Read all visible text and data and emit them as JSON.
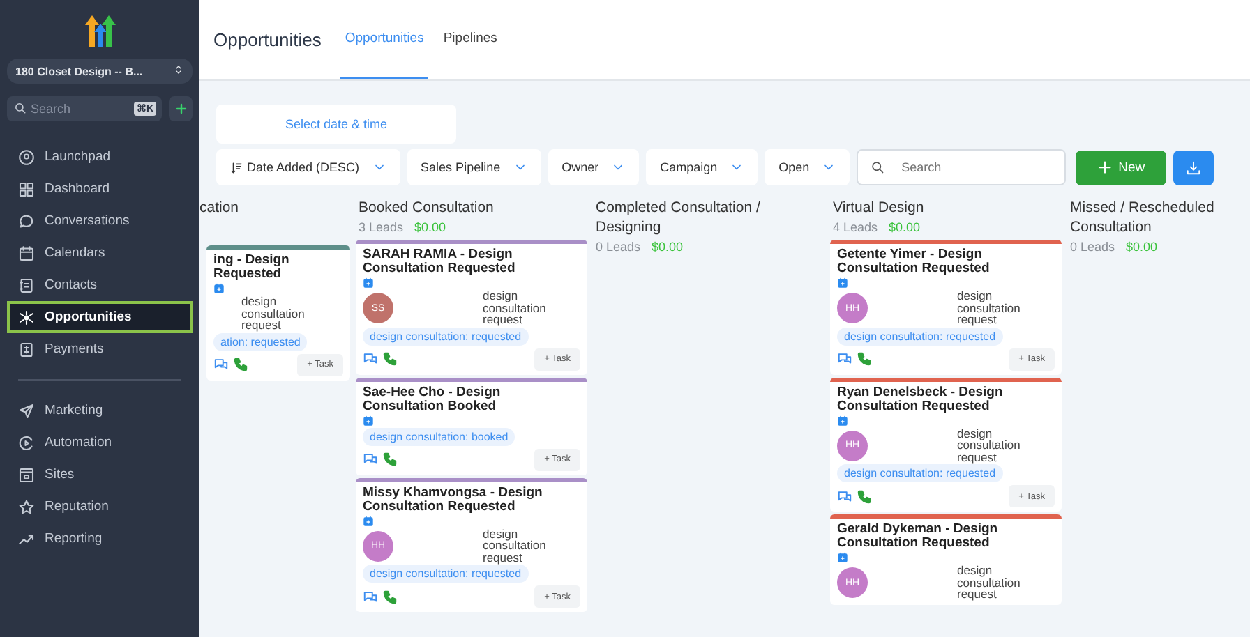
{
  "sidebar": {
    "account": "180 Closet Design -- B...",
    "search": {
      "placeholder": "Search",
      "shortcut": "⌘K"
    },
    "nav": [
      {
        "label": "Launchpad",
        "selected": false
      },
      {
        "label": "Dashboard",
        "selected": false
      },
      {
        "label": "Conversations",
        "selected": false
      },
      {
        "label": "Calendars",
        "selected": false
      },
      {
        "label": "Contacts",
        "selected": false
      },
      {
        "label": "Opportunities",
        "selected": true
      },
      {
        "label": "Payments",
        "selected": false
      }
    ],
    "nav_secondary": [
      {
        "label": "Marketing",
        "selected": false
      },
      {
        "label": "Automation",
        "selected": false
      },
      {
        "label": "Sites",
        "selected": false
      },
      {
        "label": "Reputation",
        "selected": false
      },
      {
        "label": "Reporting",
        "selected": false
      }
    ]
  },
  "header": {
    "title": "Opportunities",
    "tabs": [
      {
        "label": "Opportunities",
        "selected": true
      },
      {
        "label": "Pipelines",
        "selected": false
      }
    ]
  },
  "toolbar": {
    "date_picker": "Select date & time",
    "filters": [
      {
        "label": "Date Added (DESC)",
        "kind": "sort"
      },
      {
        "label": "Sales Pipeline",
        "kind": "select"
      },
      {
        "label": "Owner",
        "kind": "select"
      },
      {
        "label": "Campaign",
        "kind": "select"
      },
      {
        "label": "Open",
        "kind": "select"
      }
    ],
    "search": {
      "placeholder": "Search"
    },
    "new_button": "New"
  },
  "columns": [
    {
      "title": "cation",
      "color": "#5e8f8a",
      "cards": [
        {
          "title": "ing - Design Requested",
          "note": "design consultation request",
          "tag": "ation: requested",
          "task": "+ Task"
        }
      ]
    },
    {
      "title": "Booked Consultation",
      "leads": "3 Leads",
      "value": "$0.00",
      "color": "#a98fc7",
      "cards": [
        {
          "title": "SARAH RAMIA - Design Consultation Requested",
          "avatar": {
            "initials": "SS",
            "color": "#c0726b"
          },
          "note": "design consultation request",
          "tag": "design consultation: requested",
          "task": "+ Task"
        },
        {
          "title": "Sae-Hee Cho - Design Consultation Booked",
          "tag": "design consultation: booked",
          "task": "+ Task"
        },
        {
          "title": "Missy Khamvongsa - Design Consultation Requested",
          "avatar": {
            "initials": "HH",
            "color": "#c47cc8"
          },
          "note": "design consultation request",
          "tag": "design consultation: requested",
          "task": "+ Task"
        }
      ]
    },
    {
      "title": "Completed Consultation / Designing",
      "leads": "0 Leads",
      "value": "$0.00"
    },
    {
      "title": "Virtual Design",
      "leads": "4 Leads",
      "value": "$0.00",
      "color": "#e0634f",
      "cards": [
        {
          "title": "Getente Yimer - Design Consultation Requested",
          "avatar": {
            "initials": "HH",
            "color": "#c47cc8"
          },
          "note": "design consultation request",
          "tag": "design consultation: requested",
          "task": "+ Task"
        },
        {
          "title": "Ryan Denelsbeck - Design Consultation Requested",
          "avatar": {
            "initials": "HH",
            "color": "#c47cc8"
          },
          "note": "design consultation request",
          "tag": "design consultation: requested",
          "task": "+ Task"
        },
        {
          "title": "Gerald Dykeman - Design Consultation Requested",
          "avatar": {
            "initials": "HH",
            "color": "#c47cc8"
          },
          "note": "design consultation request"
        }
      ]
    },
    {
      "title": "Missed / Rescheduled Consultation",
      "leads": "0 Leads",
      "value": "$0.00"
    }
  ]
}
